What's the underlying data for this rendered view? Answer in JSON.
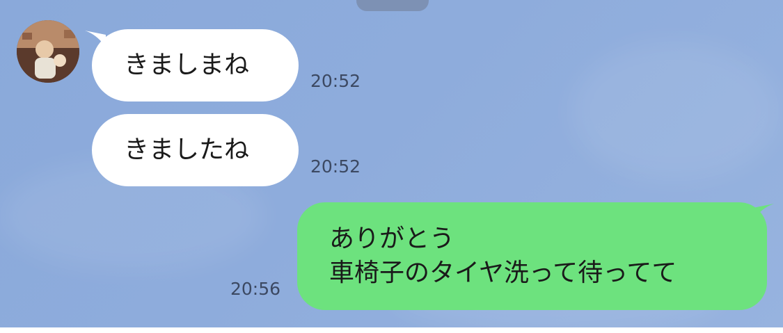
{
  "chat": {
    "messages": [
      {
        "direction": "incoming",
        "text": "きましまね",
        "time": "20:52",
        "has_avatar": true
      },
      {
        "direction": "incoming",
        "text": "きましたね",
        "time": "20:52",
        "has_avatar": false
      },
      {
        "direction": "outgoing",
        "lines": [
          "ありがとう",
          "車椅子のタイヤ洗って待ってて"
        ],
        "time": "20:56"
      }
    ]
  },
  "colors": {
    "background": "#8eacdc",
    "incoming_bubble": "#ffffff",
    "outgoing_bubble": "#6de27e",
    "timestamp": "#3c4962"
  }
}
